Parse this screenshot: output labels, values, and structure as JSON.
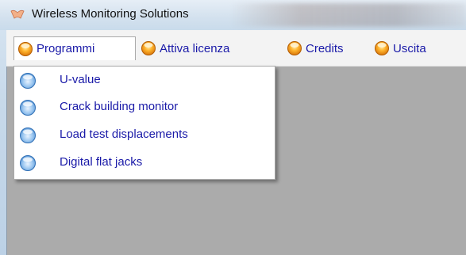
{
  "window": {
    "title": "Wireless Monitoring Solutions"
  },
  "menubar": {
    "items": [
      {
        "label": "Programmi",
        "icon": "orange-orb-icon"
      },
      {
        "label": "Attiva licenza",
        "icon": "orange-orb-icon"
      },
      {
        "label": "Credits",
        "icon": "orange-orb-icon"
      },
      {
        "label": "Uscita",
        "icon": "orange-orb-icon"
      }
    ]
  },
  "dropdown": {
    "items": [
      {
        "label": "U-value",
        "icon": "blue-orb-icon"
      },
      {
        "label": "Crack building monitor",
        "icon": "blue-orb-icon"
      },
      {
        "label": "Load test displacements",
        "icon": "blue-orb-icon"
      },
      {
        "label": "Digital flat jacks",
        "icon": "blue-orb-icon"
      }
    ]
  },
  "colors": {
    "menu_text": "#1a1aa8",
    "client_background": "#ababab",
    "menubar_background": "#f3f3f3"
  }
}
